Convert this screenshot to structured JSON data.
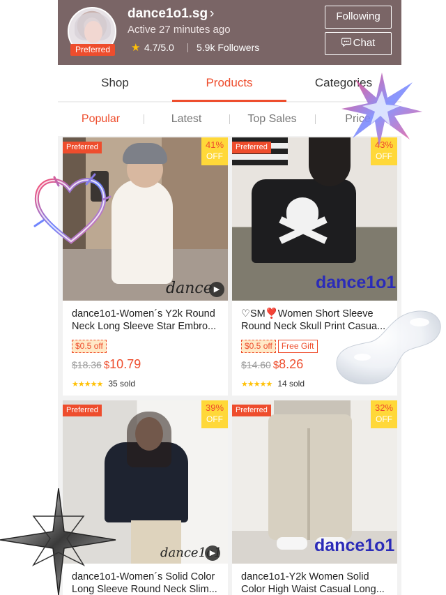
{
  "shop": {
    "name": "dance1o1.sg",
    "active": "Active 27 minutes ago",
    "rating": "4.7/5.0",
    "followers": "5.9k Followers",
    "preferred_badge": "Preferred",
    "following_label": "Following",
    "chat_label": "Chat"
  },
  "tabs": {
    "shop": "Shop",
    "products": "Products",
    "categories": "Categories"
  },
  "sort": {
    "popular": "Popular",
    "latest": "Latest",
    "top_sales": "Top Sales",
    "price": "Price"
  },
  "products": [
    {
      "preferred": "Preferred",
      "discount": "41%",
      "off": "OFF",
      "watermark": "dance",
      "title": "dance1o1-Women´s Y2k Round Neck Long Sleeve Star Embro...",
      "voucher": "$0.5 off",
      "old_price": "$18.36",
      "currency": "$",
      "price": "10.79",
      "sold": "35 sold",
      "stars": "★★★★★"
    },
    {
      "preferred": "Preferred",
      "discount": "43%",
      "off": "OFF",
      "watermark": "dance1o1",
      "title": "♡SM❣️Women Short Sleeve Round Neck Skull Print Casua...",
      "voucher": "$0.5 off",
      "gift": "Free Gift",
      "old_price": "$14.60",
      "currency": "$",
      "price": "8.26",
      "sold": "14 sold",
      "stars": "★★★★★"
    },
    {
      "preferred": "Preferred",
      "discount": "39%",
      "off": "OFF",
      "watermark": "dance1o1",
      "title": "dance1o1-Women´s Solid Color Long Sleeve Round Neck Slim..."
    },
    {
      "preferred": "Preferred",
      "discount": "32%",
      "off": "OFF",
      "watermark": "dance1o1",
      "title": "dance1o1-Y2k Women Solid Color High Waist Casual Long..."
    }
  ],
  "colors": {
    "accent": "#ee4d2d",
    "header_bg": "#7a6566",
    "discount_bg": "#ffd839",
    "star": "#ffc107"
  },
  "icons": [
    "chevron-right-icon",
    "star-icon",
    "chat-bubble-icon",
    "play-icon"
  ]
}
